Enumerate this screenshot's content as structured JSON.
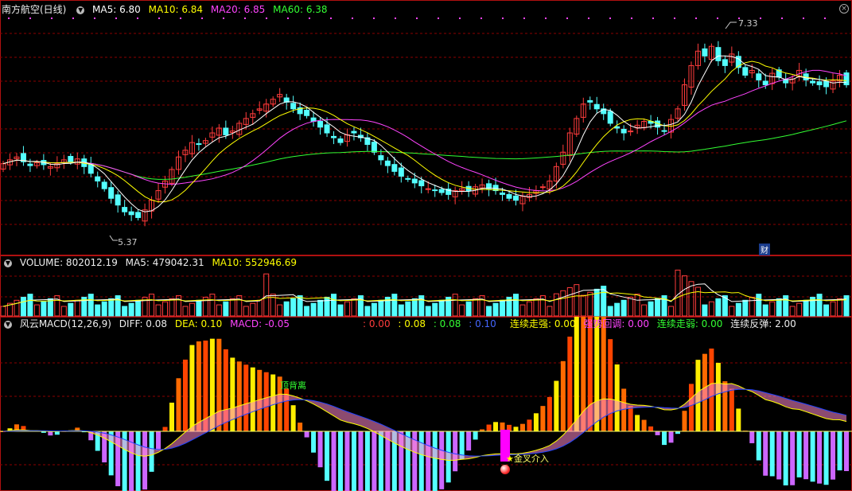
{
  "header": {
    "stock_name": "南方航空(日线)",
    "ma5": "MA5: 6.80",
    "ma10": "MA10: 6.84",
    "ma20": "MA20: 6.85",
    "ma60": "MA60: 6.38",
    "high_label": "7.33",
    "low_label": "5.37",
    "fin_badge": "财"
  },
  "volume_header": {
    "volume": "VOLUME: 802012.19",
    "ma5": "MA5: 479042.31",
    "ma10": "MA10: 552946.69"
  },
  "macd_header": {
    "name": "风云MACD(12,26,9)",
    "diff": "DIFF: 0.08",
    "dea": "DEA: 0.10",
    "macd": "MACD: -0.05",
    "v1": ": 0.00",
    "v2": ": 0.08",
    "v3": ": 0.08",
    "v4": ": 0.10",
    "s1": "连续走强: 0.00",
    "s2": "强势回调: 0.00",
    "s3": "连续走弱: 0.00",
    "s4": "连续反弹: 2.00",
    "ann_top_div": "顶背离",
    "ann_golden": "金叉介入"
  },
  "colors": {
    "up": "#ff3c3c",
    "down": "#54ffff",
    "ma5": "#ffffff",
    "ma10": "#ffff00",
    "ma20": "#ff44ff",
    "ma60": "#33ff33",
    "grid": "#8b0000"
  },
  "chart_data": {
    "type": "candlestick",
    "price_axis_range": [
      5.2,
      7.45
    ],
    "high": 7.33,
    "low": 5.37,
    "closes": [
      5.98,
      6.02,
      6.05,
      6.0,
      5.96,
      5.99,
      5.97,
      5.95,
      5.98,
      6.02,
      6.0,
      6.03,
      5.95,
      5.88,
      5.8,
      5.72,
      5.62,
      5.55,
      5.48,
      5.45,
      5.42,
      5.5,
      5.6,
      5.7,
      5.8,
      5.92,
      6.05,
      6.12,
      6.2,
      6.18,
      6.22,
      6.3,
      6.35,
      6.28,
      6.32,
      6.4,
      6.45,
      6.5,
      6.55,
      6.6,
      6.65,
      6.7,
      6.62,
      6.55,
      6.5,
      6.48,
      6.42,
      6.36,
      6.3,
      6.25,
      6.2,
      6.28,
      6.3,
      6.25,
      6.18,
      6.1,
      6.02,
      5.96,
      5.9,
      5.85,
      5.82,
      5.78,
      5.75,
      5.72,
      5.7,
      5.68,
      5.66,
      5.7,
      5.72,
      5.7,
      5.74,
      5.76,
      5.72,
      5.7,
      5.66,
      5.62,
      5.6,
      5.64,
      5.66,
      5.7,
      5.74,
      5.8,
      5.95,
      6.1,
      6.3,
      6.45,
      6.6,
      6.62,
      6.55,
      6.5,
      6.4,
      6.35,
      6.3,
      6.32,
      6.38,
      6.42,
      6.4,
      6.36,
      6.32,
      6.44,
      6.55,
      6.8,
      7.0,
      7.15,
      7.1,
      7.2,
      7.05,
      7.0,
      7.12,
      6.98,
      6.9,
      6.95,
      6.85,
      6.8,
      6.92,
      6.88,
      6.82,
      6.86,
      6.95,
      6.85,
      6.82,
      6.8,
      6.78,
      6.84,
      6.9,
      6.8
    ]
  }
}
